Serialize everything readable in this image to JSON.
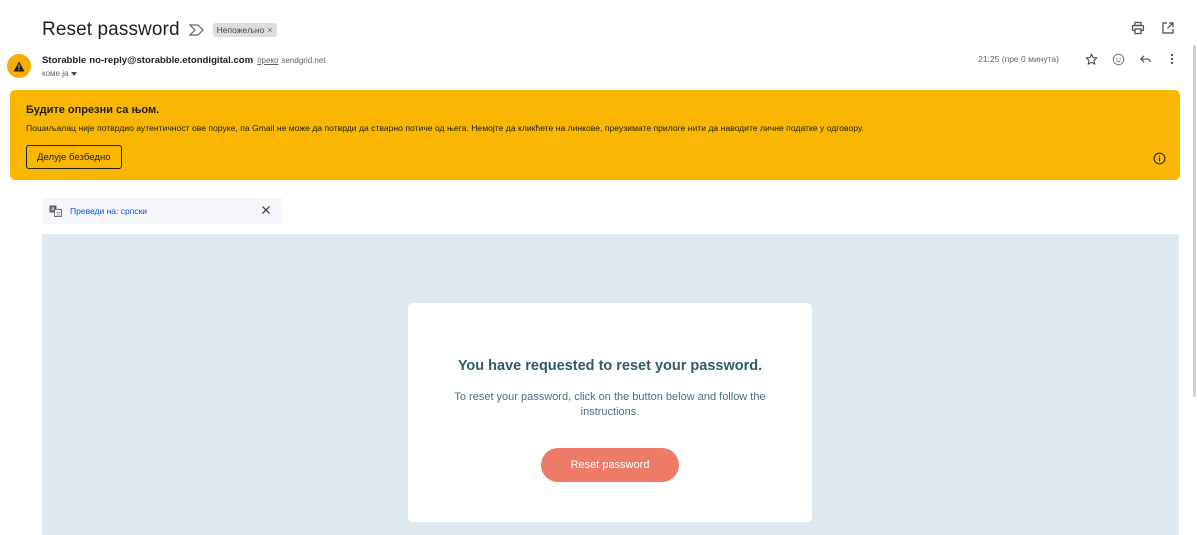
{
  "email": {
    "subject": "Reset password",
    "label_chip": "Непожељно",
    "label_chip_close": "×",
    "sender_name": "Storabble",
    "sender_email": "no-reply@storabble.etondigital.com",
    "via_text": "преко",
    "via_domain": "sendgrid.net",
    "recipient": "коме ја",
    "timestamp": "21:25 (пре 0 минута)"
  },
  "warning": {
    "title": "Будите опрезни са њом.",
    "text": "Пошиљалац није потврдио аутентичност ове поруке, па Gmail не може да потврди да стварно потиче од њега. Немојте да кликћете на линкове, преузимате прилоге нити да наводите личне податке у одговору.",
    "button_label": "Делује безбедно",
    "color": "#f9b703"
  },
  "translate": {
    "link_label": "Преведи на: српски"
  },
  "body": {
    "card_title": "You have requested to reset your password.",
    "card_text": "To reset your password, click on the button below and follow the instructions.",
    "button_label": "Reset password",
    "button_color": "#ee7b67",
    "background_color": "#dde9ef"
  },
  "icons": {
    "importance": "importance-marker-icon",
    "print": "print-icon",
    "open_new_window": "open-in-new-window-icon",
    "sender_warning": "warning-triangle-icon",
    "star": "star-icon",
    "emoji": "emoji-reaction-icon",
    "reply": "reply-icon",
    "more": "more-vertical-icon",
    "info": "info-icon",
    "translate": "translate-icon",
    "close": "close-icon"
  }
}
